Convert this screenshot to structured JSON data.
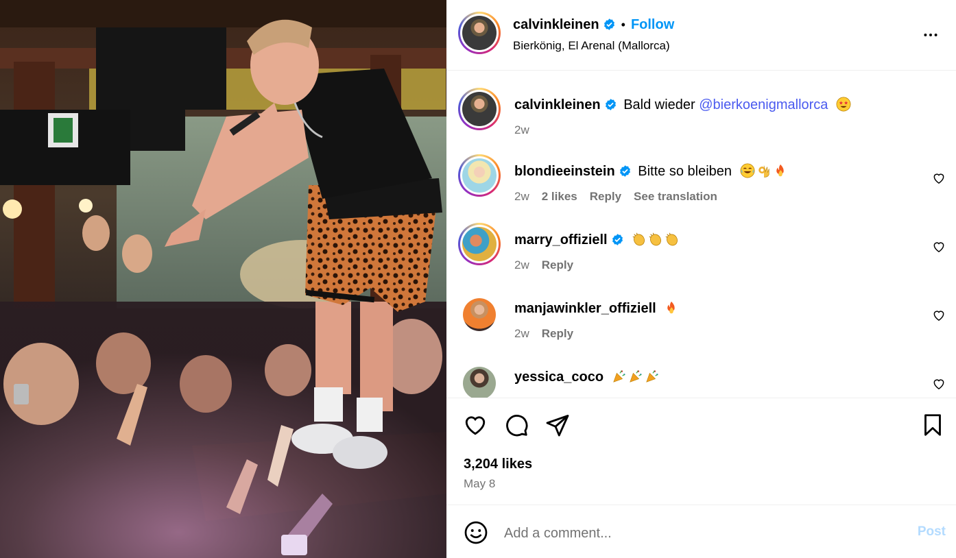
{
  "post": {
    "author": "calvinkleinen",
    "verified": true,
    "follow_label": "Follow",
    "location": "Bierkönig, El Arenal (Mallorca)",
    "photo_alt": "Performer with microphone on stage above a crowd",
    "likes": "3,204 likes",
    "date": "May 8"
  },
  "caption": {
    "username": "calvinkleinen",
    "text_prefix": "Bald wieder ",
    "mention": "@bierkoenigmallorca",
    "emoji": "star-struck-face",
    "time": "2w"
  },
  "comments": [
    {
      "username": "blondieeinstein",
      "verified": true,
      "text": "Bitte so bleiben",
      "emojis": [
        "tears-of-joy",
        "ok-hand",
        "fire"
      ],
      "time": "2w",
      "likes": "2 likes",
      "reply": "Reply",
      "translation": "See translation"
    },
    {
      "username": "marry_offiziell",
      "verified": true,
      "text": "",
      "emojis": [
        "clapping-hands",
        "clapping-hands",
        "clapping-hands"
      ],
      "time": "2w",
      "reply": "Reply"
    },
    {
      "username": "manjawinkler_offiziell",
      "verified": false,
      "text": "",
      "emojis": [
        "fire"
      ],
      "time": "2w",
      "reply": "Reply"
    },
    {
      "username": "yessica_coco",
      "verified": false,
      "text": "",
      "emojis": [
        "party-popper",
        "party-popper",
        "party-popper"
      ]
    }
  ],
  "icons": {
    "like": "heart-icon",
    "comment": "comment-icon",
    "share": "share-icon",
    "save": "bookmark-icon",
    "more": "more-options-icon",
    "emoji_picker": "smiley-icon"
  },
  "compose": {
    "placeholder": "Add a comment...",
    "post_label": "Post"
  },
  "colors": {
    "link_blue": "#0095f6",
    "mention": "#4a5aef",
    "muted": "#737373",
    "verified_badge": "#0095f6",
    "post_disabled": "#b3dbff"
  }
}
